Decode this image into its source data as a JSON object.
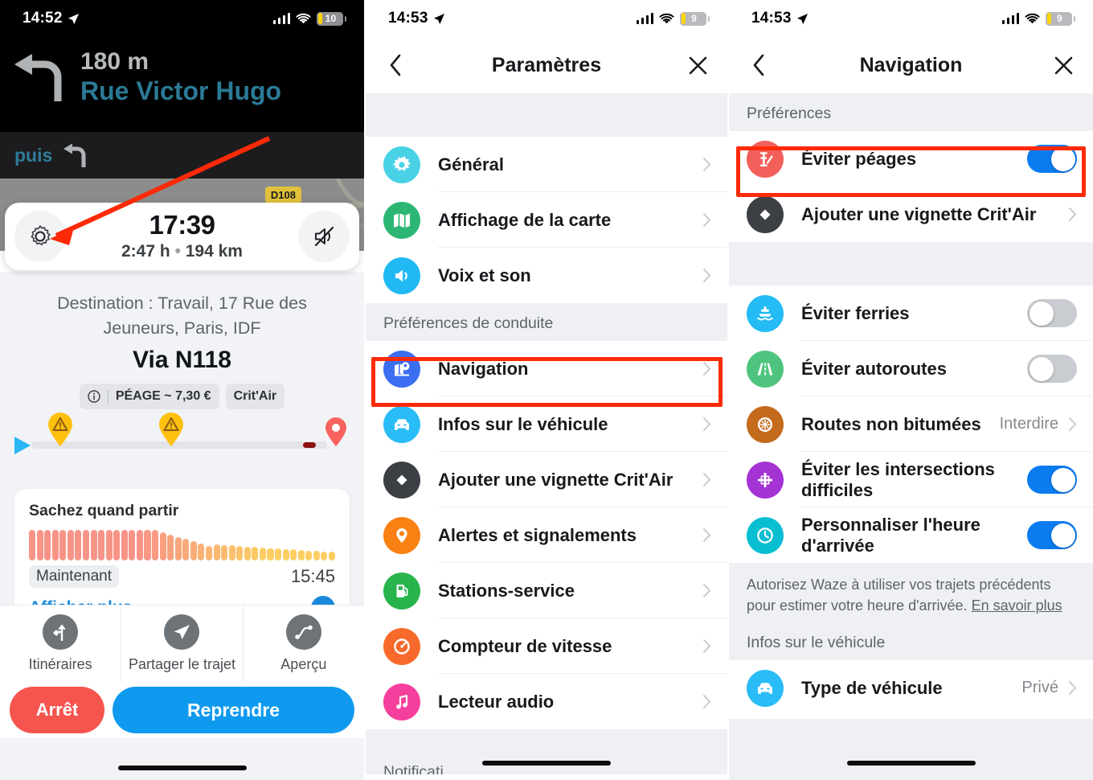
{
  "panel1": {
    "status": {
      "time": "14:52",
      "battery": "10"
    },
    "navigation": {
      "distance": "180 m",
      "street": "Rue Victor Hugo",
      "then_label": "puis",
      "road_shield": "D108"
    },
    "eta": {
      "arrival_time": "17:39",
      "duration": "2:47 h",
      "separator": "•",
      "distance": "194 km",
      "settings_icon": "gear-icon",
      "mute_icon": "volume-muted-icon"
    },
    "route": {
      "destination": "Destination : Travail, 17 Rue des Jeuneurs, Paris, IDF",
      "via": "Via N118",
      "toll_chip": "PÉAGE ~ 7,30 €",
      "critair_chip": "Crit'Air"
    },
    "depart_card": {
      "title": "Sachez quand partir",
      "now_label": "Maintenant",
      "end_label": "15:45",
      "show_more": "Afficher plus"
    },
    "actions": [
      {
        "label": "Itinéraires",
        "icon": "routes-fork-icon"
      },
      {
        "label": "Partager le trajet",
        "icon": "share-paperplane-icon"
      },
      {
        "label": "Aperçu",
        "icon": "route-overview-icon"
      }
    ],
    "buttons": {
      "stop": "Arrêt",
      "resume": "Reprendre"
    }
  },
  "panel2": {
    "status": {
      "time": "14:53",
      "battery": "9"
    },
    "header": {
      "title": "Paramètres",
      "back_icon": "chevron-left-icon",
      "close_icon": "close-x-icon"
    },
    "group1": [
      {
        "label": "Général",
        "icon": "gear-icon",
        "color": "#49d2e6"
      },
      {
        "label": "Affichage de la carte",
        "icon": "map-icon",
        "color": "#2cb673"
      },
      {
        "label": "Voix et son",
        "icon": "speaker-icon",
        "color": "#20b9f4"
      }
    ],
    "group2_title": "Préférences de conduite",
    "group2": [
      {
        "label": "Navigation",
        "icon": "navigation-map-pin-icon",
        "color": "#3b6ef0",
        "highlighted": true
      },
      {
        "label": "Infos sur le véhicule",
        "icon": "car-icon",
        "color": "#29bcf7"
      },
      {
        "label": "Ajouter une vignette Crit'Air",
        "icon": "critair-diamond-icon",
        "color": "#3c3f43"
      },
      {
        "label": "Alertes et signalements",
        "icon": "alert-pin-icon",
        "color": "#f98012"
      },
      {
        "label": "Stations-service",
        "icon": "gas-pump-icon",
        "color": "#28b44c"
      },
      {
        "label": "Compteur de vitesse",
        "icon": "speedometer-icon",
        "color": "#f86a2c"
      },
      {
        "label": "Lecteur audio",
        "icon": "music-note-icon",
        "color": "#f53f9c"
      }
    ],
    "clipped_section": "Notificati"
  },
  "panel3": {
    "status": {
      "time": "14:53",
      "battery": "9"
    },
    "header": {
      "title": "Navigation",
      "back_icon": "chevron-left-icon",
      "close_icon": "close-x-icon"
    },
    "preferences_title": "Préférences",
    "preferences": [
      {
        "label": "Éviter péages",
        "icon": "toll-barrier-icon",
        "color": "#f2605c",
        "control": "toggle",
        "value": "on",
        "highlighted": true
      },
      {
        "label": "Ajouter une vignette Crit'Air",
        "icon": "critair-diamond-icon",
        "color": "#3c3f43",
        "control": "chevron"
      }
    ],
    "avoid_group": [
      {
        "label": "Éviter ferries",
        "icon": "ferry-icon",
        "color": "#25bbf5",
        "control": "toggle",
        "value": "off"
      },
      {
        "label": "Éviter autoroutes",
        "icon": "highway-icon",
        "color": "#4ec47e",
        "control": "toggle",
        "value": "off"
      },
      {
        "label": "Routes non bitumées",
        "icon": "dirt-road-tire-icon",
        "color": "#c46a1d",
        "control": "chevron",
        "value": "Interdire"
      },
      {
        "label": "Éviter les intersections difficiles",
        "icon": "intersection-icon",
        "color": "#a433d4",
        "control": "toggle",
        "value": "on"
      },
      {
        "label": "Personnaliser l'heure d'arrivée",
        "icon": "clock-icon",
        "color": "#09bed1",
        "control": "toggle",
        "value": "on"
      }
    ],
    "footnote_text": "Autorisez Waze à utiliser vos trajets précédents pour estimer votre heure d'arrivée. ",
    "footnote_link": "En savoir plus",
    "vehicle_title": "Infos sur le véhicule",
    "vehicle": [
      {
        "label": "Type de véhicule",
        "icon": "car-icon",
        "color": "#29bcf7",
        "control": "chevron",
        "value": "Privé"
      }
    ]
  },
  "annotations": {
    "highlight_color": "#fe2a07",
    "arrow_color": "#fe2a07"
  }
}
